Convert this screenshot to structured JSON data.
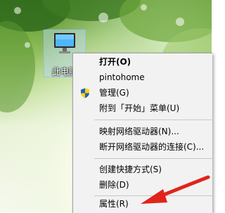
{
  "desktop": {
    "icon_label": "此电脑"
  },
  "context_menu": {
    "items": [
      {
        "label": "打开(O)",
        "bold": true
      },
      {
        "label": "pintohome"
      },
      {
        "label": "管理(G)",
        "icon": "uac-shield-icon"
      },
      {
        "label": "附到「开始」菜单(U)"
      },
      {
        "label": "映射网络驱动器(N)..."
      },
      {
        "label": "断开网络驱动器的连接(C)..."
      },
      {
        "label": "创建快捷方式(S)"
      },
      {
        "label": "删除(D)"
      },
      {
        "label": "属性(R)"
      }
    ]
  },
  "annotation": {
    "arrow_color": "#e0241b"
  }
}
